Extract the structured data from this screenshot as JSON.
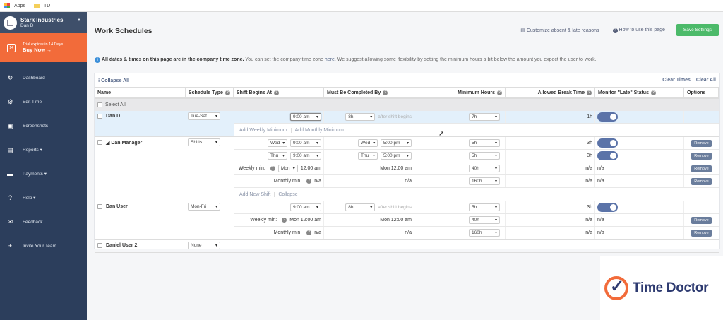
{
  "browser": {
    "apps": "Apps",
    "bookmark": "TD"
  },
  "sidebar": {
    "org": "Stark Industries",
    "user": "Dan D",
    "trial_text": "Trial expires in 14 Days",
    "buy": "Buy Now",
    "cal_day": "14",
    "items": [
      {
        "label": "Dashboard",
        "icon": "↻",
        "name": "dashboard"
      },
      {
        "label": "Edit Time",
        "icon": "⚙",
        "name": "edit-time"
      },
      {
        "label": "Screenshots",
        "icon": "▣",
        "name": "screenshots"
      },
      {
        "label": "Reports ▾",
        "icon": "▤",
        "name": "reports"
      },
      {
        "label": "Payments ▾",
        "icon": "▬",
        "name": "payments"
      },
      {
        "label": "Help ▾",
        "icon": "?",
        "name": "help"
      },
      {
        "label": "Feedback",
        "icon": "✉",
        "name": "feedback"
      },
      {
        "label": "Invite Your Team",
        "icon": "+",
        "name": "invite-your-team"
      }
    ]
  },
  "header": {
    "title": "Work Schedules",
    "customize": "Customize absent & late reasons",
    "howto": "How to use this page",
    "save": "Save Settings"
  },
  "info": {
    "bold": "All dates & times on this page are in the company time zone.",
    "text1": " You can set the company time zone ",
    "link": "here",
    "text2": ". We suggest allowing some flexibility by setting the minimum hours a bit below the amount you expect the user to work."
  },
  "table": {
    "collapse_all": "Collapse All",
    "clear_times": "Clear Times",
    "clear_all": "Clear All",
    "select_all": "Select All",
    "columns": [
      "Name",
      "Schedule Type",
      "Shift Begins At",
      "Must Be Completed By",
      "Minimum Hours",
      "Allowed Break Time",
      "Monitor \"Late\" Status",
      "Options"
    ],
    "groups": [
      {
        "name": "Dan D",
        "type": "Tue-Sat",
        "highlight": true,
        "rows": [
          {
            "begin": {
              "time": "9:00 am",
              "focus": true
            },
            "end": {
              "dur": "8h",
              "suffix": "after shift begins"
            },
            "min": "7h",
            "brk": "1h",
            "monitor": "toggle",
            "remove": false
          }
        ],
        "links": [
          "Add Weekly Minimum",
          "Add Monthly Minimum"
        ]
      },
      {
        "name": "◢ Dan Manager",
        "type": "Shifts",
        "rows": [
          {
            "begin": {
              "day": "Wed",
              "time": "9:00 am"
            },
            "end": {
              "day": "Wed",
              "time": "5:00 pm"
            },
            "min": "5h",
            "brk": "3h",
            "monitor": "toggle",
            "remove": true
          },
          {
            "begin": {
              "day": "Thu",
              "time": "9:00 am"
            },
            "end": {
              "day": "Thu",
              "time": "5:00 pm"
            },
            "min": "5h",
            "brk": "3h",
            "monitor": "toggle",
            "remove": true
          },
          {
            "begin": {
              "label": "Weekly min:",
              "day": "Mon",
              "text": "12:00 am"
            },
            "end": {
              "text": "Mon 12:00 am"
            },
            "min": "40h",
            "brk": "n/a",
            "monitor": "n/a",
            "remove": true
          },
          {
            "begin": {
              "label": "Monthly min:",
              "text": "n/a"
            },
            "end": {
              "text": "n/a"
            },
            "min": "160h",
            "brk": "n/a",
            "monitor": "n/a",
            "remove": true
          }
        ],
        "links": [
          "Add New Shift",
          "Collapse"
        ]
      },
      {
        "name": "Dan User",
        "type": "Mon-Fri",
        "rows": [
          {
            "begin": {
              "time": "9:00 am"
            },
            "end": {
              "dur": "8h",
              "suffix": "after shift begins"
            },
            "min": "5h",
            "brk": "3h",
            "monitor": "toggle",
            "remove": false
          },
          {
            "begin": {
              "label": "Weekly min:",
              "text": "Mon 12:00 am"
            },
            "end": {
              "text": "Mon 12:00 am"
            },
            "min": "40h",
            "brk": "n/a",
            "monitor": "n/a",
            "remove": true
          },
          {
            "begin": {
              "label": "Monthly min:",
              "text": "n/a"
            },
            "end": {
              "text": "n/a"
            },
            "min": "160h",
            "brk": "n/a",
            "monitor": "n/a",
            "remove": true
          }
        ]
      },
      {
        "name": "Daniel User 2",
        "type": "None",
        "rows": []
      }
    ],
    "remove_label": "Remove"
  },
  "branding": {
    "logo_text": "Time Doctor"
  },
  "colors": {
    "sidebar": "#2c3e5c",
    "accent": "#f26b3a",
    "save": "#4cba6a",
    "toggle": "#5b73a8"
  }
}
